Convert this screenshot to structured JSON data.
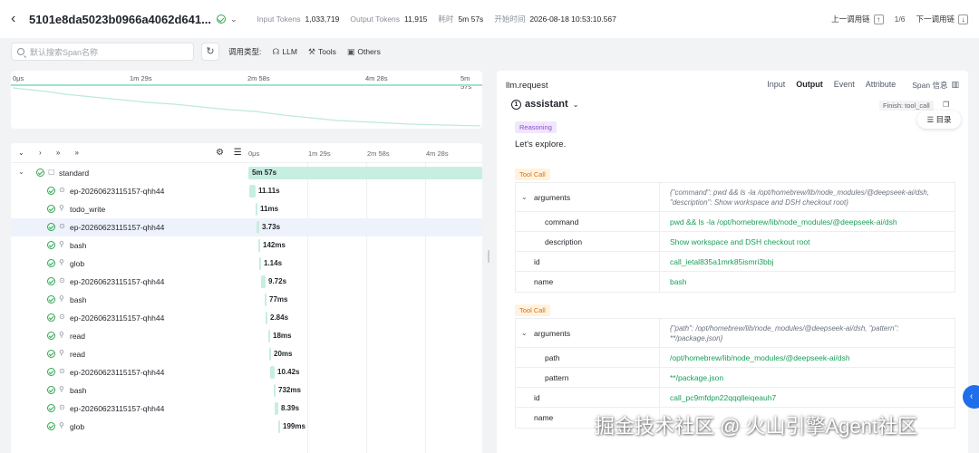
{
  "header": {
    "trace_id": "5101e8da5023b0966a4062d641...",
    "input_tokens_label": "Input Tokens",
    "input_tokens": "1,033,719",
    "output_tokens_label": "Output Tokens",
    "output_tokens": "11,915",
    "elapsed_label": "耗时",
    "elapsed": "5m 57s",
    "start_label": "开始时间",
    "start": "2026-08-18 10:53:10.567",
    "prev_label": "上一调用链",
    "pager": "1/6",
    "next_label": "下一调用链"
  },
  "filter": {
    "search_placeholder": "默认搜索Span名称",
    "type_label": "调用类型:",
    "chips": [
      "LLM",
      "Tools",
      "Others"
    ]
  },
  "timeline": {
    "ticks": [
      "0μs",
      "1m 29s",
      "2m 58s",
      "4m 28s",
      "5m 57s"
    ]
  },
  "span_panel": {
    "axis_ticks": [
      "0μs",
      "1m 29s",
      "2m 58s",
      "4m 28s"
    ],
    "rows": [
      {
        "name": "standard",
        "duration": "5m 57s",
        "depth": 0
      },
      {
        "name": "ep-20260623115157-qhh44",
        "duration": "11.11s",
        "depth": 1
      },
      {
        "name": "todo_write",
        "duration": "11ms",
        "depth": 1
      },
      {
        "name": "ep-20260623115157-qhh44",
        "duration": "3.73s",
        "depth": 1
      },
      {
        "name": "bash",
        "duration": "142ms",
        "depth": 1
      },
      {
        "name": "glob",
        "duration": "1.14s",
        "depth": 1
      },
      {
        "name": "ep-20260623115157-qhh44",
        "duration": "9.72s",
        "depth": 1
      },
      {
        "name": "bash",
        "duration": "77ms",
        "depth": 1
      },
      {
        "name": "ep-20260623115157-qhh44",
        "duration": "2.84s",
        "depth": 1
      },
      {
        "name": "read",
        "duration": "18ms",
        "depth": 1
      },
      {
        "name": "read",
        "duration": "20ms",
        "depth": 1
      },
      {
        "name": "ep-20260623115157-qhh44",
        "duration": "10.42s",
        "depth": 1
      },
      {
        "name": "bash",
        "duration": "732ms",
        "depth": 1
      },
      {
        "name": "ep-20260623115157-qhh44",
        "duration": "8.39s",
        "depth": 1
      },
      {
        "name": "glob",
        "duration": "199ms",
        "depth": 1
      }
    ]
  },
  "detail": {
    "title": "llm.request",
    "tabs": [
      "Input",
      "Output",
      "Event",
      "Attribute"
    ],
    "active_tab": "Output",
    "span_info_label": "Span 信息",
    "role_index": "1",
    "role": "assistant",
    "finish": "Finish: tool_call",
    "toc_label": "目录",
    "reasoning_label": "Reasoning",
    "reasoning_text": "Let's explore.",
    "tool_call_label": "Tool Call",
    "tool_calls": [
      {
        "arguments_key": "arguments",
        "arguments_json": "{\"command\": pwd && ls -la /opt/homebrew/lib/node_modules/@deepseek-ai/dsh, \"description\": Show workspace and DSH checkout root}",
        "sub": [
          {
            "key": "command",
            "value": "pwd && ls -la /opt/homebrew/lib/node_modules/@deepseek-ai/dsh"
          },
          {
            "key": "description",
            "value": "Show workspace and DSH checkout root"
          }
        ],
        "id_key": "id",
        "id": "call_ietal835a1mrk85ismri3bbj",
        "name_key": "name",
        "name": "bash"
      },
      {
        "arguments_key": "arguments",
        "arguments_json": "{\"path\": /opt/homebrew/lib/node_modules/@deepseek-ai/dsh, \"pattern\": **/package.json}",
        "sub": [
          {
            "key": "path",
            "value": "/opt/homebrew/lib/node_modules/@deepseek-ai/dsh"
          },
          {
            "key": "pattern",
            "value": "**/package.json"
          }
        ],
        "id_key": "id",
        "id": "call_pc9mfdpn22qqqlleiqeauh7",
        "name_key": "name",
        "name": ""
      }
    ]
  },
  "watermark": "掘金技术社区 @ 火山引擎Agent社区",
  "colors": {
    "accent": "#1f6feb",
    "bar": "#c6eee1",
    "ok": "#2fa84f",
    "value_green": "#18a058",
    "reasoning": "#8b4bd8",
    "toolcall": "#e0700a"
  }
}
